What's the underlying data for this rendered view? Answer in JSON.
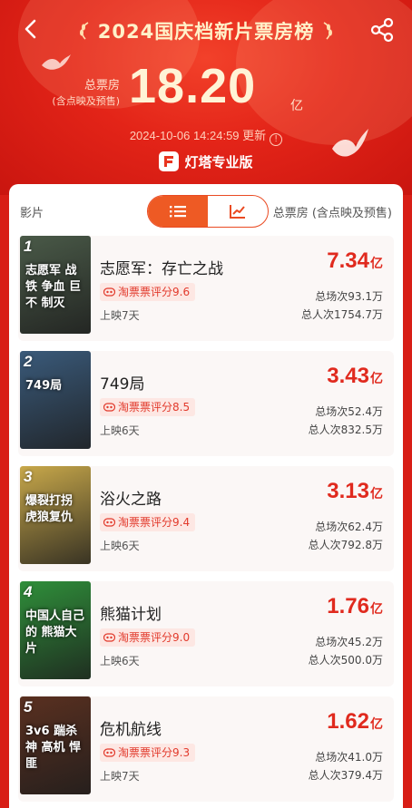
{
  "header": {
    "title": "2024国庆档新片票房榜",
    "total_label": "总票房",
    "total_sub": "(含点映及预售)",
    "total_value": "18.20",
    "total_unit": "亿",
    "updated": "2024-10-06 14:24:59 更新",
    "brand": "灯塔专业版"
  },
  "colors": {
    "accent": "#e02a1e",
    "toggle": "#ee5a24",
    "hero": "#e32418"
  },
  "list_header": {
    "col_film": "影片",
    "col_gross": "总票房 (含点映及预售)",
    "view_list_icon": "list-icon",
    "view_chart_icon": "trend-chart-icon"
  },
  "movies": [
    {
      "rank": "1",
      "title": "志愿军：存亡之战",
      "score": "淘票票评分9.6",
      "days": "上映7天",
      "gross": "7.34",
      "unit": "亿",
      "sessions": "总场次93.1万",
      "viewers": "总人次1754.7万",
      "poster_text": "志愿军 战铁 争血 巨不 制灭",
      "poster_color": "#4a5a48"
    },
    {
      "rank": "2",
      "title": "749局",
      "score": "淘票票评分8.5",
      "days": "上映6天",
      "gross": "3.43",
      "unit": "亿",
      "sessions": "总场次52.4万",
      "viewers": "总人次832.5万",
      "poster_text": "749局",
      "poster_color": "#3a5a7a"
    },
    {
      "rank": "3",
      "title": "浴火之路",
      "score": "淘票票评分9.4",
      "days": "上映6天",
      "gross": "3.13",
      "unit": "亿",
      "sessions": "总场次62.4万",
      "viewers": "总人次792.8万",
      "poster_text": "爆裂打拐 虎狼复仇",
      "poster_color": "#c8a84a"
    },
    {
      "rank": "4",
      "title": "熊猫计划",
      "score": "淘票票评分9.0",
      "days": "上映6天",
      "gross": "1.76",
      "unit": "亿",
      "sessions": "总场次45.2万",
      "viewers": "总人次500.0万",
      "poster_text": "中国人自己的 熊猫大片",
      "poster_color": "#2f8f3a"
    },
    {
      "rank": "5",
      "title": "危机航线",
      "score": "淘票票评分9.3",
      "days": "上映7天",
      "gross": "1.62",
      "unit": "亿",
      "sessions": "总场次41.0万",
      "viewers": "总人次379.4万",
      "poster_text": "3v6 踹杀神 高机 悍匪",
      "poster_color": "#5a3020"
    }
  ]
}
